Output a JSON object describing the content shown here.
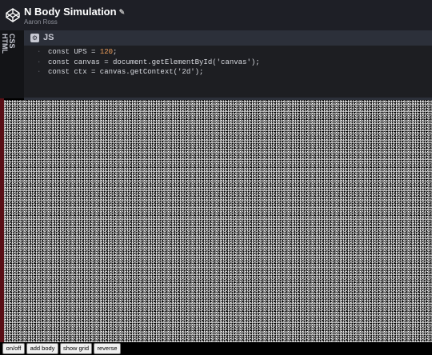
{
  "header": {
    "title": "N Body Simulation",
    "author": "Aaron Ross"
  },
  "side_tabs": {
    "css": "CSS",
    "html": "HTML"
  },
  "editor": {
    "language": "JS",
    "lines": [
      {
        "prefix": "const UPS = ",
        "value": "120",
        "suffix": ";"
      },
      {
        "text": "const canvas = document.getElementById('canvas');"
      },
      {
        "text": "const ctx = canvas.getContext('2d');"
      }
    ]
  },
  "buttons": {
    "on_off": "on/off",
    "add_body": "add body",
    "show_grid": "show grid",
    "reverse": "reverse"
  },
  "colors": {
    "header_bg": "#1e1f26",
    "editor_bg": "#1d1e22",
    "number_accent": "#f2a05b",
    "left_rail": "#5a0f16"
  }
}
